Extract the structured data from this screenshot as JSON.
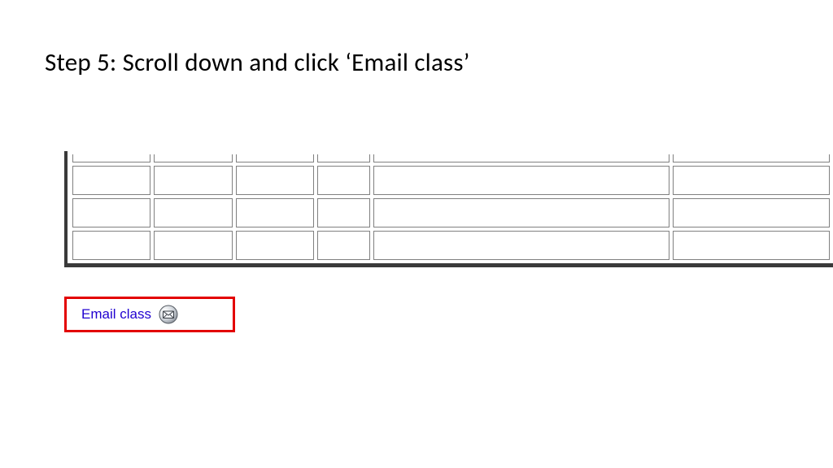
{
  "heading": "Step 5: Scroll down and click ‘Email class’",
  "grid": {
    "columns": 6,
    "visible_rows": 3,
    "partial_top_row": true
  },
  "action": {
    "email_class_label": "Email class",
    "icon": "mail-icon",
    "highlight_color": "#e30000",
    "link_color": "#2000d0"
  }
}
